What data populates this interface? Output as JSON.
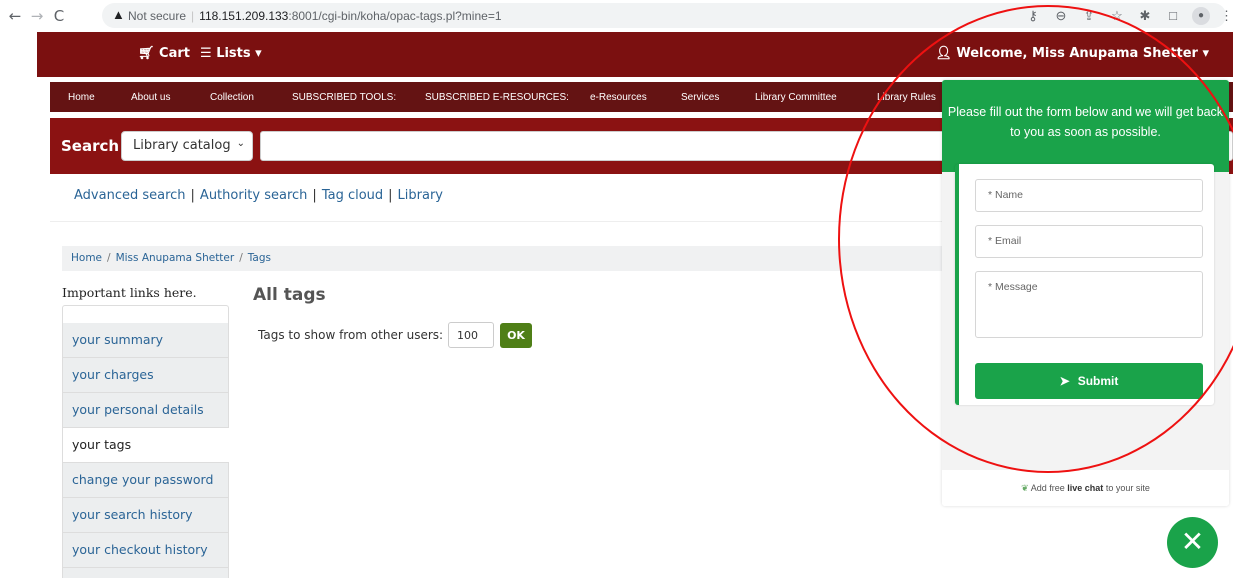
{
  "browser": {
    "insecure_label": "Not secure",
    "url_host": "118.151.209.133",
    "url_path": ":8001/cgi-bin/koha/opac-tags.pl?mine=1",
    "icons": [
      "back-icon",
      "forward-icon",
      "reload-icon",
      "warning-icon",
      "key-icon",
      "zoom-icon",
      "share-icon",
      "star-icon",
      "extensions-icon",
      "sidepanel-icon",
      "profile-icon",
      "menu-icon"
    ]
  },
  "header": {
    "cart": "Cart",
    "lists": "Lists",
    "welcome": "Welcome, Miss Anupama Shetter"
  },
  "nav": {
    "items": [
      "Home",
      "About us",
      "Collection",
      "SUBSCRIBED TOOLS:",
      "SUBSCRIBED E-RESOURCES:",
      "e-Resources",
      "Services",
      "Library Committee",
      "Library Rules"
    ]
  },
  "search": {
    "label": "Search",
    "scope": "Library catalog"
  },
  "links": {
    "advanced": "Advanced search",
    "authority": "Authority search",
    "tag_cloud": "Tag cloud",
    "library": "Library"
  },
  "breadcrumb": {
    "home": "Home",
    "user": "Miss Anupama Shetter",
    "current": "Tags"
  },
  "sidebar": {
    "title": "Important links here.",
    "items": [
      {
        "label": "your summary"
      },
      {
        "label": "your charges"
      },
      {
        "label": "your personal details"
      },
      {
        "label": "your tags"
      },
      {
        "label": "change your password"
      },
      {
        "label": "your search history"
      },
      {
        "label": "your checkout history"
      }
    ]
  },
  "main": {
    "title": "All tags",
    "tags_label": "Tags to show from other users:",
    "tags_value": "100",
    "ok": "OK"
  },
  "chat": {
    "intro": "Please fill out the form below and we will get back to you as soon as possible.",
    "name_placeholder": "* Name",
    "email_placeholder": "* Email",
    "message_placeholder": "* Message",
    "submit": "Submit",
    "footer_prefix": "Add free",
    "footer_bold": "live chat",
    "footer_suffix": "to your site",
    "accent": "#1aa34a"
  },
  "colors": {
    "header_maroon": "#7b1010",
    "nav_maroon": "#641313",
    "search_maroon": "#8b1212",
    "ok_green": "#4f7f17",
    "annotation_red": "#ee1111"
  }
}
